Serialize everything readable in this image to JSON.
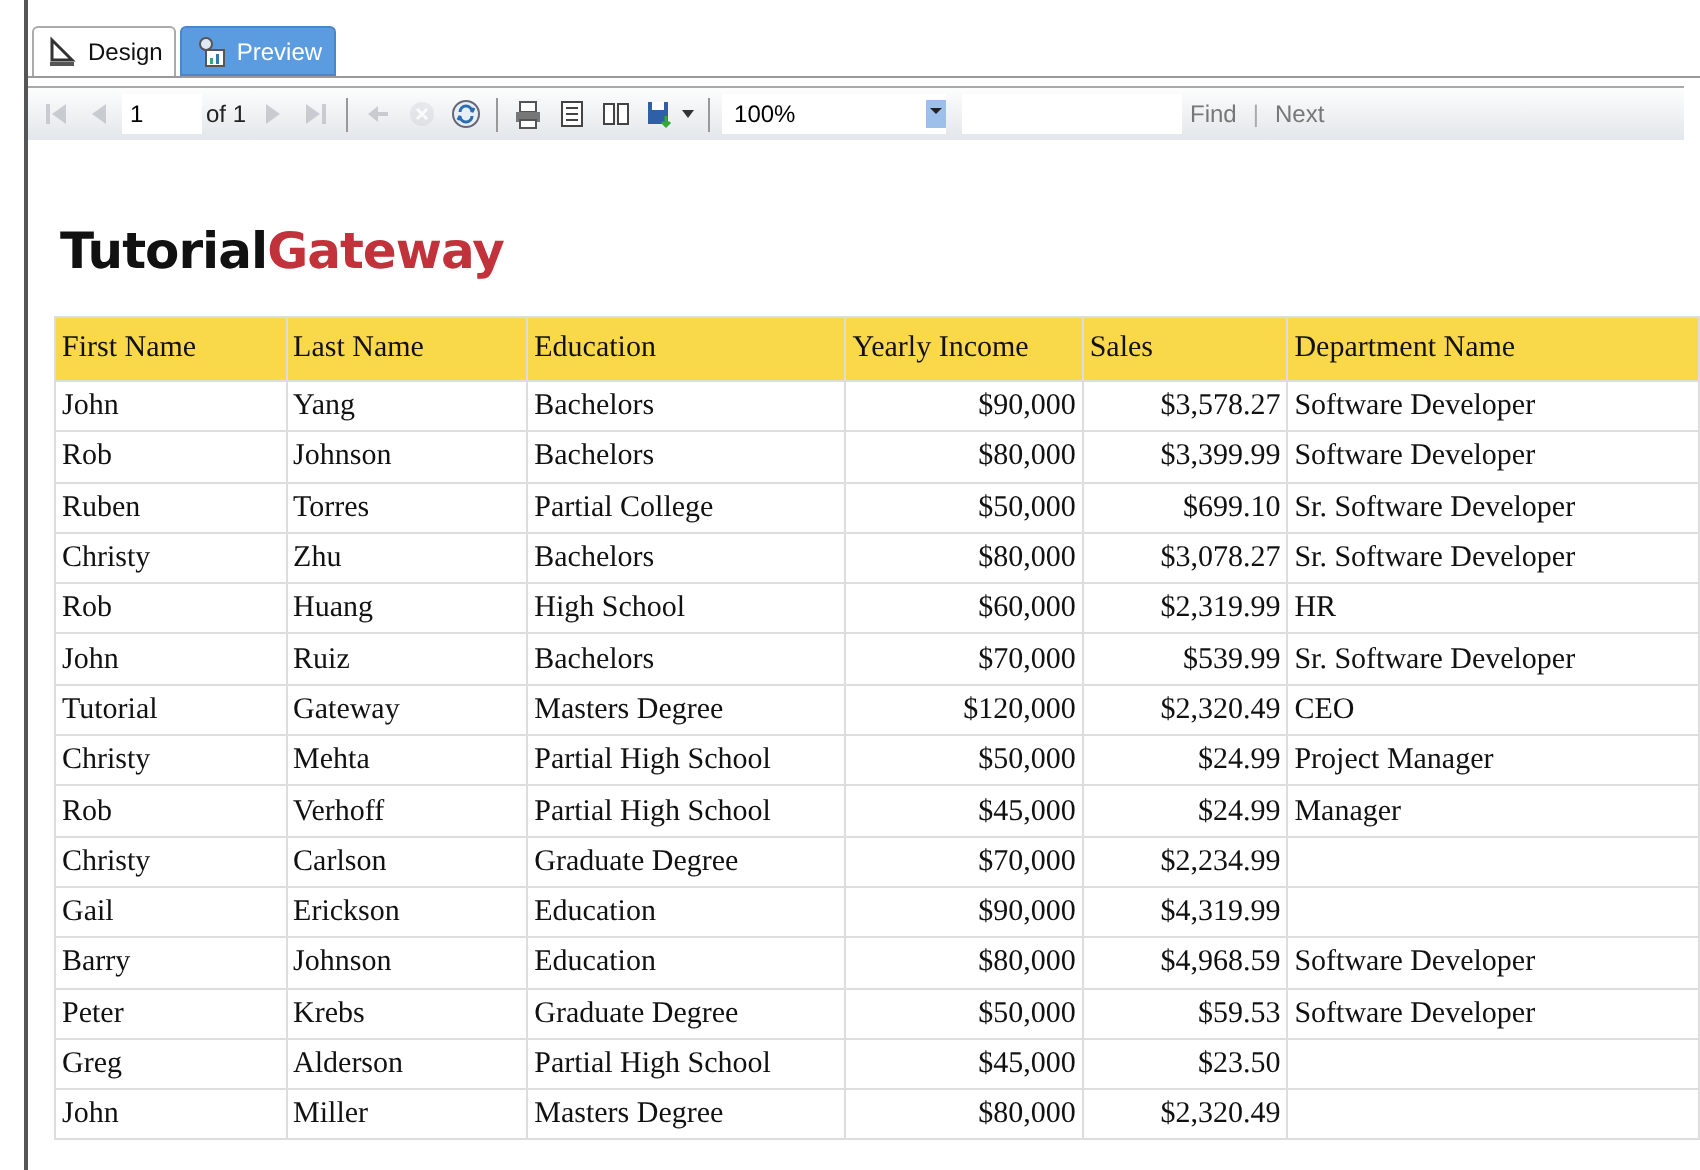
{
  "tabs": [
    {
      "label": "Design",
      "selected": false
    },
    {
      "label": "Preview",
      "selected": true
    }
  ],
  "toolbar": {
    "nav": [
      {
        "kind": "first",
        "disabled": true
      },
      {
        "kind": "prev",
        "disabled": true
      }
    ],
    "page": "1",
    "of_label": "of 1",
    "nav2": [
      {
        "kind": "next",
        "disabled": true
      },
      {
        "kind": "last",
        "disabled": true
      }
    ],
    "actions": [
      {
        "kind": "back",
        "disabled": true
      },
      {
        "kind": "stop",
        "disabled": true
      },
      {
        "kind": "refresh",
        "disabled": false
      }
    ],
    "tools": [
      {
        "kind": "print",
        "disabled": false
      },
      {
        "kind": "layout",
        "disabled": false
      },
      {
        "kind": "setup",
        "disabled": false
      },
      {
        "kind": "export",
        "disabled": false
      }
    ],
    "zoom": "100%",
    "find": "Find",
    "separator": "|",
    "next": "Next"
  },
  "logo": [
    {
      "text": "Tutorial",
      "color": "#111111"
    },
    {
      "text": "Gateway",
      "color": "#c1323b"
    }
  ],
  "table": {
    "columns": [
      "First Name",
      "Last Name",
      "Education",
      "Yearly Income",
      "Sales",
      "Department Name"
    ],
    "rows": [
      [
        "John",
        "Yang",
        "Bachelors",
        "$90,000",
        "$3,578.27",
        "Software Developer"
      ],
      [
        "Rob",
        "Johnson",
        "Bachelors",
        "$80,000",
        "$3,399.99",
        "Software Developer"
      ],
      [
        "Ruben",
        "Torres",
        "Partial College",
        "$50,000",
        "$699.10",
        "Sr. Software Developer"
      ],
      [
        "Christy",
        "Zhu",
        "Bachelors",
        "$80,000",
        "$3,078.27",
        "Sr. Software Developer"
      ],
      [
        "Rob",
        "Huang",
        "High School",
        "$60,000",
        "$2,319.99",
        "HR"
      ],
      [
        "John",
        "Ruiz",
        "Bachelors",
        "$70,000",
        "$539.99",
        "Sr. Software Developer"
      ],
      [
        "Tutorial",
        "Gateway",
        "Masters Degree",
        "$120,000",
        "$2,320.49",
        "CEO"
      ],
      [
        "Christy",
        "Mehta",
        "Partial High School",
        "$50,000",
        "$24.99",
        "Project Manager"
      ],
      [
        "Rob",
        "Verhoff",
        "Partial High School",
        "$45,000",
        "$24.99",
        "Manager"
      ],
      [
        "Christy",
        "Carlson",
        "Graduate Degree",
        "$70,000",
        "$2,234.99",
        ""
      ],
      [
        "Gail",
        "Erickson",
        "Education",
        "$90,000",
        "$4,319.99",
        ""
      ],
      [
        "Barry",
        "Johnson",
        "Education",
        "$80,000",
        "$4,968.59",
        "Software Developer"
      ],
      [
        "Peter",
        "Krebs",
        "Graduate Degree",
        "$50,000",
        "$59.53",
        "Software Developer"
      ],
      [
        "Greg",
        "Alderson",
        "Partial High School",
        "$45,000",
        "$23.50",
        ""
      ],
      [
        "John",
        "Miller",
        "Masters Degree",
        "$80,000",
        "$2,320.49",
        ""
      ]
    ]
  }
}
